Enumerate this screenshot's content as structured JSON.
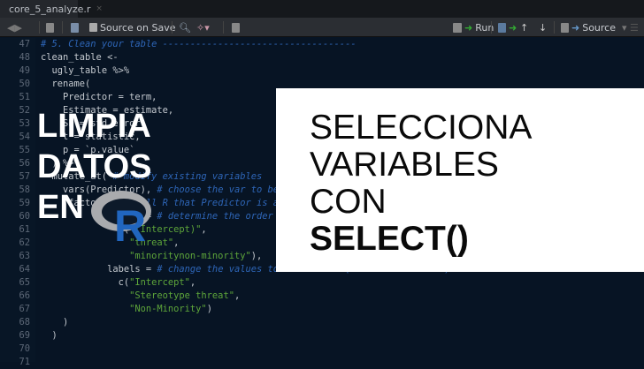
{
  "tab": {
    "filename": "core_5_analyze.r",
    "close": "×"
  },
  "toolbar": {
    "source_on_save": "Source on Save",
    "run": "Run",
    "source": "Source"
  },
  "code": [
    {
      "n": "47",
      "parts": [
        [
          "cm",
          "# 5. Clean your table -----------------------------------"
        ]
      ]
    },
    {
      "n": "48",
      "parts": [
        [
          "",
          "clean_table <-"
        ]
      ]
    },
    {
      "n": "49",
      "parts": [
        [
          "",
          "  ugly_table %>%"
        ]
      ]
    },
    {
      "n": "50",
      "parts": [
        [
          "",
          "  rename("
        ]
      ]
    },
    {
      "n": "51",
      "parts": [
        [
          "",
          "    Predictor = term,"
        ]
      ]
    },
    {
      "n": "52",
      "parts": [
        [
          "",
          "    Estimate = estimate,"
        ]
      ]
    },
    {
      "n": "53",
      "parts": [
        [
          "",
          "    SE = std.error,"
        ]
      ]
    },
    {
      "n": "54",
      "parts": [
        [
          "",
          "    t = statistic,"
        ]
      ]
    },
    {
      "n": "55",
      "parts": [
        [
          "",
          "    p = `p.value`"
        ]
      ]
    },
    {
      "n": "56",
      "parts": [
        [
          "",
          "  ) %>%"
        ]
      ]
    },
    {
      "n": "57",
      "parts": [
        [
          "",
          "  mutate_at( "
        ],
        [
          "cm",
          "# modify existing variables"
        ]
      ]
    },
    {
      "n": "58",
      "parts": [
        [
          "",
          "    vars(Predictor), "
        ],
        [
          "cm",
          "# choose the var to be modified"
        ]
      ]
    },
    {
      "n": "59",
      "parts": [
        [
          "",
          "     factor(., "
        ],
        [
          "cm",
          "# tell R that Predictor is a factor"
        ]
      ]
    },
    {
      "n": "60",
      "parts": [
        [
          "",
          "            levels = "
        ],
        [
          "cm",
          "# determine the order"
        ]
      ]
    },
    {
      "n": "61",
      "parts": [
        [
          "",
          "              c("
        ],
        [
          "st",
          "\"(Intercept)\""
        ],
        [
          "",
          ","
        ]
      ]
    },
    {
      "n": "62",
      "parts": [
        [
          "",
          "                "
        ],
        [
          "st",
          "\"threat\""
        ],
        [
          "",
          ","
        ]
      ]
    },
    {
      "n": "63",
      "parts": [
        [
          "",
          "                "
        ],
        [
          "st",
          "\"minoritynon-minority\""
        ],
        [
          "",
          "),"
        ]
      ]
    },
    {
      "n": "64",
      "parts": [
        [
          "",
          "            labels = "
        ],
        [
          "cm",
          "# change the values to the labels (in the same order)"
        ]
      ]
    },
    {
      "n": "65",
      "parts": [
        [
          "",
          "              c("
        ],
        [
          "st",
          "\"Intercept\""
        ],
        [
          "",
          ","
        ]
      ]
    },
    {
      "n": "66",
      "parts": [
        [
          "",
          "                "
        ],
        [
          "st",
          "\"Stereotype threat\""
        ],
        [
          "",
          ","
        ]
      ]
    },
    {
      "n": "67",
      "parts": [
        [
          "",
          "                "
        ],
        [
          "st",
          "\"Non-Minority\""
        ],
        [
          "",
          ")"
        ]
      ]
    },
    {
      "n": "68",
      "parts": [
        [
          "",
          "    )"
        ]
      ]
    },
    {
      "n": "69",
      "parts": [
        [
          "",
          "  )"
        ]
      ]
    },
    {
      "n": "70",
      "parts": [
        [
          "",
          ""
        ]
      ]
    },
    {
      "n": "71",
      "parts": [
        [
          "",
          ""
        ]
      ]
    }
  ],
  "overlay": {
    "left_lines": [
      "LIMPIA",
      "DATOS",
      "EN"
    ],
    "logo_text": "R",
    "box_lines": [
      "SELECCIONA",
      "VARIABLES",
      "CON"
    ],
    "box_bold": "SELECT()"
  }
}
